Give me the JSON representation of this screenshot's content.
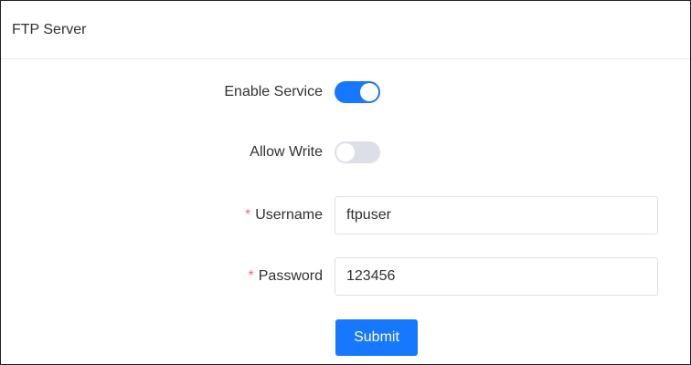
{
  "header": {
    "title": "FTP Server"
  },
  "form": {
    "enable_service": {
      "label": "Enable Service",
      "state": "on"
    },
    "allow_write": {
      "label": "Allow Write",
      "state": "off"
    },
    "username": {
      "label": "Username",
      "required_mark": "*",
      "value": "ftpuser"
    },
    "password": {
      "label": "Password",
      "required_mark": "*",
      "value": "123456"
    },
    "submit_label": "Submit"
  },
  "colors": {
    "accent": "#1677ff",
    "toggle_off": "#dcdfe6",
    "required": "#f56c6c",
    "border": "#dcdfe6"
  }
}
